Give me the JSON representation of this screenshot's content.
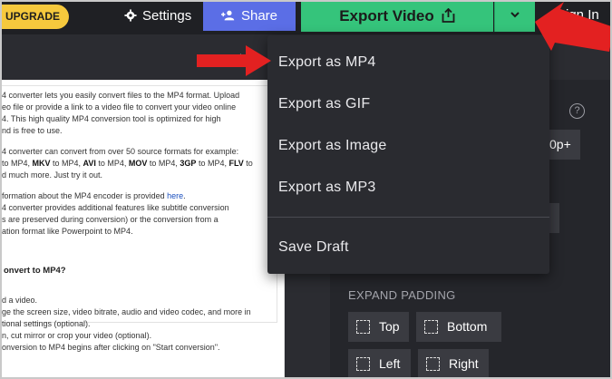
{
  "topbar": {
    "upgrade_label": "UPGRADE",
    "settings_label": "Settings",
    "share_label": "Share",
    "export_label": "Export Video",
    "signin_label": "Sign In"
  },
  "export_menu": {
    "items": [
      {
        "label": "Export as MP4"
      },
      {
        "label": "Export as GIF"
      },
      {
        "label": "Export as Image"
      },
      {
        "label": "Export as MP3"
      },
      {
        "label": "Save Draft"
      }
    ]
  },
  "document": {
    "lines_top": [
      "4 converter lets you easily convert files to the MP4 format. Upload",
      "eo file or provide a link to a video file to convert your video online",
      "4. This high quality MP4 conversion tool is optimized for high",
      "nd is free to use."
    ],
    "formats_line_1": "4 converter can convert from over 50 source formats for example:",
    "formats_line_2_pre": " to MP4, ",
    "formats_line_2_mkv": "MKV",
    "formats_line_2_mid1": " to MP4, ",
    "formats_line_2_avi": "AVI",
    "formats_line_2_mid2": " to MP4, ",
    "formats_line_2_mov": "MOV",
    "formats_line_2_mid3": " to MP4, ",
    "formats_line_2_3gp": "3GP",
    "formats_line_2_mid4": " to MP4, ",
    "formats_line_2_flv": "FLV",
    "formats_line_2_post": " to",
    "formats_line_3": "d much more. Just try it out.",
    "info_line_1_pre": "formation about the MP4 encoder is provided ",
    "info_line_1_link": "here",
    "info_line_1_post": ".",
    "info_lines": [
      "4 converter provides additional features like subtitle conversion",
      "s are preserved during conversion) or the conversion from a",
      "ation format like Powerpoint to MP4."
    ],
    "heading": "onvert to MP4?",
    "steps": [
      "d a video.",
      "ge the screen size, video bitrate, audio and video codec, and more in",
      "tional settings (optional).",
      "n, cut mirror or crop your video (optional).",
      "onversion to MP4 begins after clicking on \"Start conversion\"."
    ]
  },
  "right_panel": {
    "help_label": "?",
    "resolution_value": "0p+",
    "expand_padding_label": "EXPAND PADDING",
    "padding_buttons": {
      "top": "Top",
      "bottom": "Bottom",
      "left": "Left",
      "right": "Right"
    }
  },
  "colors": {
    "upgrade_bg": "#f6c93d",
    "share_bg": "#5b6ee6",
    "export_bg": "#35c47b",
    "annotation_arrow": "#e32121",
    "menu_bg": "#2a2b30"
  }
}
